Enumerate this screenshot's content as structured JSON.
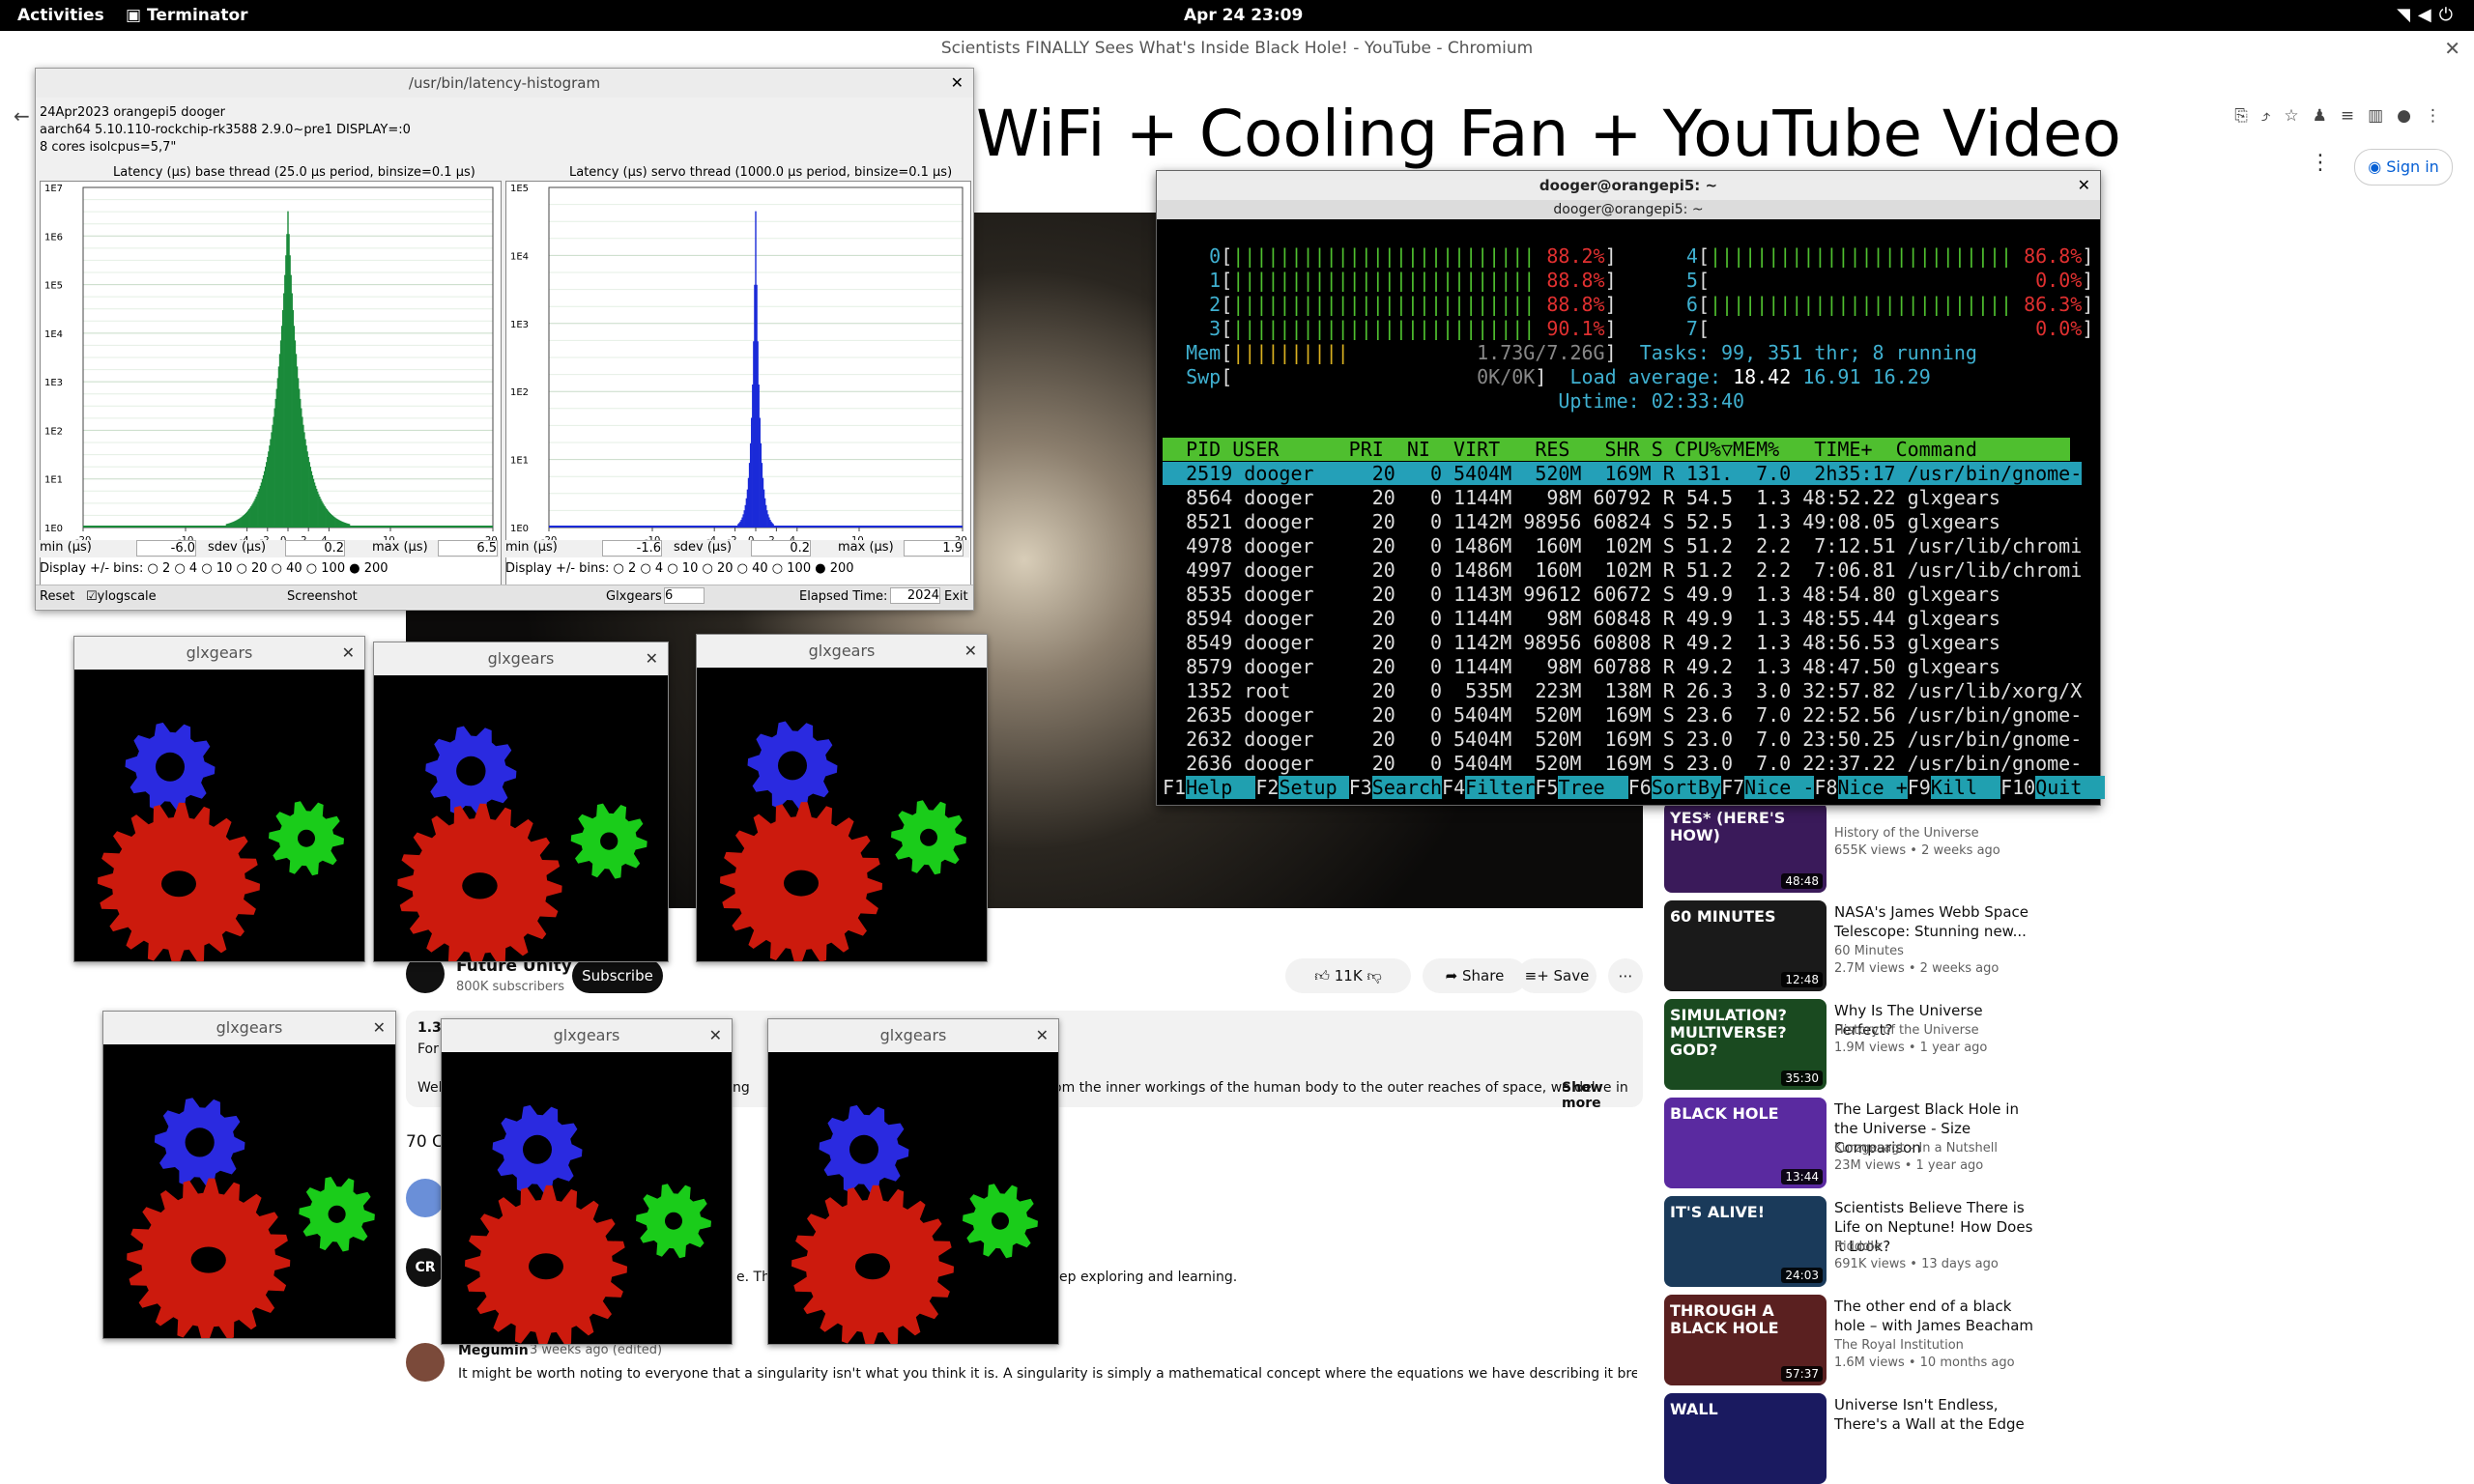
{
  "topbar": {
    "activities": "Activities",
    "app": "Terminator",
    "clock": "Apr 24  23:09"
  },
  "chromium": {
    "title": "Scientists FINALLY Sees What's Inside Black Hole! - YouTube - Chromium"
  },
  "youtube": {
    "overlay_title": "WiFi + Cooling Fan + YouTube Video",
    "signin": "Sign in",
    "channel": "Future Unity",
    "subscribers": "800K subscribers",
    "subscribe": "Subscribe",
    "likes": "11K",
    "share": "Share",
    "save": "Save",
    "desc_views": "1.3M",
    "desc_line2": "For",
    "desc_line3": "Wel",
    "desc_frag": "ating",
    "desc_tail": "om the inner workings of the human body to the outer reaches of space, we delve in",
    "show_more": "Show more",
    "comments_count": "70 Co",
    "comment1_tail": "e. The",
    "comment1_right": "ep exploring and learning.",
    "comment2_user": "Megumin",
    "comment2_time": "3 weeks ago (edited)",
    "comment2_text": "It might be worth noting to everyone that a singularity isn't what you think it is. A singularity is simply a mathematical concept where the equations we have describing it break down, and as such,",
    "recs": [
      {
        "title": "",
        "channel": "History of the Universe",
        "meta": "655K views • 2 weeks ago",
        "dur": "48:48",
        "thumb": "YES* (HERE'S HOW)"
      },
      {
        "title": "NASA's James Webb Space Telescope: Stunning new...",
        "channel": "60 Minutes",
        "meta": "2.7M views • 2 weeks ago",
        "dur": "12:48",
        "thumb": "60 MINUTES"
      },
      {
        "title": "Why Is The Universe Perfect?",
        "channel": "History of the Universe",
        "meta": "1.9M views • 1 year ago",
        "dur": "35:30",
        "thumb": "SIMULATION? MULTIVERSE? GOD?"
      },
      {
        "title": "The Largest Black Hole in the Universe - Size Comparison",
        "channel": "Kurzgesagt – In a Nutshell",
        "meta": "23M views • 1 year ago",
        "dur": "13:44",
        "thumb": "BLACK HOLE"
      },
      {
        "title": "Scientists Believe There is Life on Neptune! How Does It Look?",
        "channel": "Ridddle",
        "meta": "691K views • 13 days ago",
        "dur": "24:03",
        "thumb": "IT'S ALIVE!"
      },
      {
        "title": "The other end of a black hole – with James Beacham",
        "channel": "The Royal Institution",
        "meta": "1.6M views • 10 months ago",
        "dur": "57:37",
        "thumb": "THROUGH A BLACK HOLE"
      },
      {
        "title": "Universe Isn't Endless, There's a Wall at the Edge",
        "channel": "",
        "meta": "",
        "dur": "",
        "thumb": "WALL"
      }
    ]
  },
  "latency": {
    "window_title": "/usr/bin/latency-histogram",
    "info1": "24Apr2023 orangepi5 dooger",
    "info2": "aarch64  5.10.110-rockchip-rk3588  2.9.0~pre1  DISPLAY=:0",
    "info3": "8 cores  isolcpus=5,7\"",
    "base_title": "Latency (µs) base thread (25.0 µs period, binsize=0.1 µs)",
    "servo_title": "Latency (µs) servo thread (1000.0 µs period, binsize=0.1 µs)",
    "base_stats": {
      "min_label": "min (µs)",
      "min": "-6.0",
      "sdev_label": "sdev (µs)",
      "sdev": "0.2",
      "max_label": "max (µs)",
      "max": "6.5"
    },
    "servo_stats": {
      "min_label": "min (µs)",
      "min": "-1.6",
      "sdev_label": "sdev (µs)",
      "sdev": "0.2",
      "max_label": "max (µs)",
      "max": "1.9"
    },
    "bins_label": "Display +/- bins:",
    "bins": [
      "2",
      "4",
      "10",
      "20",
      "40",
      "100",
      "200"
    ],
    "reset": "Reset",
    "ylogscale": "ylogscale",
    "screenshot": "Screenshot",
    "glxgears_label": "Glxgears",
    "glxgears_val": "6",
    "elapsed_label": "Elapsed Time:",
    "elapsed_val": "2024",
    "exit": "Exit",
    "base_yticks": [
      "1E7",
      "1E6",
      "1E5",
      "1E4",
      "1E3",
      "1E2",
      "1E1",
      "1E0"
    ],
    "servo_yticks": [
      "1E5",
      "1E4",
      "1E3",
      "1E2",
      "1E1",
      "1E0"
    ],
    "xticks": [
      "-20",
      "-10",
      "-4",
      "-2",
      "0",
      "2",
      "4",
      "10",
      "20"
    ]
  },
  "terminal": {
    "title": "dooger@orangepi5: ~",
    "subtitle": "dooger@orangepi5: ~",
    "cpu_left": [
      [
        "0",
        "88.2%"
      ],
      [
        "1",
        "88.8%"
      ],
      [
        "2",
        "88.8%"
      ],
      [
        "3",
        "90.1%"
      ]
    ],
    "cpu_right": [
      [
        "4",
        "86.8%"
      ],
      [
        "5",
        "0.0%"
      ],
      [
        "6",
        "86.3%"
      ],
      [
        "7",
        "0.0%"
      ]
    ],
    "mem": "Mem",
    "mem_val": "1.73G/7.26G",
    "swp": "Swp",
    "swp_val": "0K/0K",
    "tasks": "Tasks: 99, 351 thr; 8 running",
    "load_label": "Load average:",
    "load1": "18.42",
    "load5": "16.91",
    "load15": "16.29",
    "uptime": "Uptime: 02:33:40",
    "header": "  PID USER      PRI  NI  VIRT   RES   SHR S CPU%▽MEM%   TIME+  Command",
    "rows": [
      "  2519 dooger     20   0 5404M  520M  169M R 131.  7.0  2h35:17 /usr/bin/gnome-",
      "  8564 dooger     20   0 1144M   98M 60792 R 54.5  1.3 48:52.22 glxgears",
      "  8521 dooger     20   0 1142M 98956 60824 S 52.5  1.3 49:08.05 glxgears",
      "  4978 dooger     20   0 1486M  160M  102M S 51.2  2.2  7:12.51 /usr/lib/chromi",
      "  4997 dooger     20   0 1486M  160M  102M R 51.2  2.2  7:06.81 /usr/lib/chromi",
      "  8535 dooger     20   0 1143M 99612 60672 S 49.9  1.3 48:54.80 glxgears",
      "  8594 dooger     20   0 1144M   98M 60848 R 49.9  1.3 48:55.44 glxgears",
      "  8549 dooger     20   0 1142M 98956 60808 R 49.2  1.3 48:56.53 glxgears",
      "  8579 dooger     20   0 1144M   98M 60788 R 49.2  1.3 48:47.50 glxgears",
      "  1352 root       20   0  535M  223M  138M R 26.3  3.0 32:57.82 /usr/lib/xorg/X",
      "  2635 dooger     20   0 5404M  520M  169M S 23.6  7.0 22:52.56 /usr/bin/gnome-",
      "  2632 dooger     20   0 5404M  520M  169M S 23.0  7.0 23:50.25 /usr/bin/gnome-",
      "  2636 dooger     20   0 5404M  520M  169M S 23.0  7.0 22:37.22 /usr/bin/gnome-"
    ],
    "fkeys": [
      [
        "F1",
        "Help"
      ],
      [
        "F2",
        "Setup"
      ],
      [
        "F3",
        "Search"
      ],
      [
        "F4",
        "Filter"
      ],
      [
        "F5",
        "Tree"
      ],
      [
        "F6",
        "SortBy"
      ],
      [
        "F7",
        "Nice -"
      ],
      [
        "F8",
        "Nice +"
      ],
      [
        "F9",
        "Kill"
      ],
      [
        "F10",
        "Quit"
      ]
    ]
  },
  "glxgears": {
    "title": "glxgears"
  },
  "colors": {
    "gear_red": "#cc1a0d",
    "gear_green": "#1acc1a",
    "gear_blue": "#2a2ae0",
    "htop_green": "#4fbf2f",
    "htop_red": "#e03030",
    "htop_cyan": "#20a0b0"
  }
}
